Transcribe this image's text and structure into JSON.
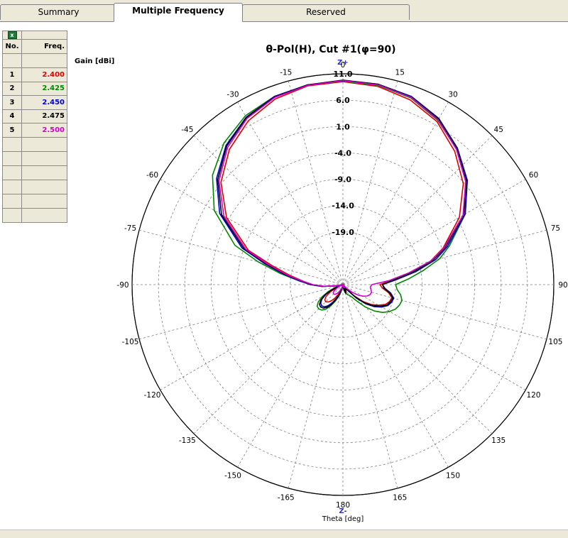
{
  "tabs": [
    {
      "label": "Summary",
      "active": false
    },
    {
      "label": "Multiple Frequency",
      "active": true
    },
    {
      "label": "Reserved",
      "active": false
    }
  ],
  "table": {
    "headers": [
      "No.",
      "Freq."
    ],
    "rows": [
      {
        "no": "1",
        "freq": "2.400",
        "color": "#e00000"
      },
      {
        "no": "2",
        "freq": "2.425",
        "color": "#008800"
      },
      {
        "no": "3",
        "freq": "2.450",
        "color": "#0000cc"
      },
      {
        "no": "4",
        "freq": "2.475",
        "color": "#000000"
      },
      {
        "no": "5",
        "freq": "2.500",
        "color": "#d000d0"
      }
    ],
    "blank_rows": 6
  },
  "chart_data": {
    "type": "polar",
    "title": "θ-Pol(H), Cut #1(φ=90)",
    "radial_label": "Gain [dBi]",
    "axis_label": "Theta [deg]",
    "top_marker": "Z+",
    "bottom_marker": "Z-",
    "radial_ticks": [
      "11.0",
      "6.0",
      "1.0",
      "-4.0",
      "-9.0",
      "-14.0",
      "-19.0"
    ],
    "radial_range": [
      -29,
      11
    ],
    "angle_step_deg": 15,
    "angle_tick_labels": [
      "0",
      "15",
      "30",
      "45",
      "60",
      "75",
      "90",
      "105",
      "120",
      "135",
      "150",
      "165",
      "180",
      "-165",
      "-150",
      "-135",
      "-120",
      "-105",
      "-90",
      "-75",
      "-60",
      "-45",
      "-30",
      "-15"
    ],
    "grid": true,
    "theta_deg": [
      0,
      10,
      20,
      30,
      40,
      50,
      60,
      70,
      75,
      80,
      85,
      90,
      95,
      100,
      105,
      110,
      115,
      120,
      125,
      130,
      135,
      140,
      145,
      150,
      155,
      160,
      165,
      170,
      175,
      180,
      -175,
      -170,
      -165,
      -160,
      -155,
      -150,
      -145,
      -140,
      -135,
      -130,
      -125,
      -120,
      -115,
      -110,
      -105,
      -100,
      -95,
      -90,
      -85,
      -80,
      -75,
      -70,
      -60,
      -50,
      -40,
      -30,
      -20,
      -10
    ],
    "series": [
      {
        "name": "2.400",
        "color": "#e00000",
        "values": [
          9.5,
          9.2,
          8.3,
          6.7,
          4.0,
          0.8,
          -3.5,
          -8.8,
          -11.8,
          -16.2,
          -19.8,
          -22.0,
          -21.5,
          -20.2,
          -19.4,
          -19.6,
          -20.1,
          -21.2,
          -22.4,
          -24.0,
          -26.0,
          -28.0,
          -28.6,
          -28.5,
          -28.0,
          -27.6,
          -27.8,
          -28.7,
          -29,
          -29,
          -29,
          -28.9,
          -28.4,
          -27.7,
          -27.0,
          -26.1,
          -25.3,
          -24.7,
          -24.4,
          -24.5,
          -25.1,
          -26.3,
          -28.0,
          -29,
          -29,
          -27.8,
          -25.3,
          -23.2,
          -21.4,
          -18.7,
          -15.1,
          -9.9,
          -3.5,
          1.2,
          4.5,
          6.9,
          8.5,
          9.3
        ]
      },
      {
        "name": "2.425",
        "color": "#008800",
        "values": [
          9.6,
          9.4,
          8.7,
          7.0,
          4.6,
          1.8,
          -2.2,
          -7.5,
          -10.0,
          -13.5,
          -16.5,
          -19.0,
          -18.7,
          -17.9,
          -17.4,
          -17.6,
          -18.0,
          -18.8,
          -19.8,
          -21.2,
          -23.0,
          -25.0,
          -26.2,
          -26.7,
          -26.9,
          -27.2,
          -27.6,
          -28.2,
          -28.8,
          -29,
          -28.9,
          -28.4,
          -27.6,
          -26.6,
          -25.5,
          -24.3,
          -23.3,
          -22.7,
          -22.5,
          -22.6,
          -23.3,
          -24.5,
          -26.0,
          -27.6,
          -28.6,
          -27.5,
          -25.0,
          -22.9,
          -20.6,
          -17.0,
          -12.4,
          -7.2,
          -0.8,
          3.3,
          6.1,
          8.0,
          9.0,
          9.5
        ]
      },
      {
        "name": "2.450",
        "color": "#0000cc",
        "values": [
          9.7,
          9.6,
          9.0,
          7.4,
          4.8,
          1.8,
          -2.2,
          -7.9,
          -10.8,
          -15.0,
          -19.0,
          -21.5,
          -21.0,
          -19.8,
          -19.0,
          -19.2,
          -19.6,
          -20.5,
          -21.7,
          -23.3,
          -25.4,
          -27.5,
          -28.2,
          -28.1,
          -27.9,
          -27.8,
          -28.0,
          -28.6,
          -29,
          -29,
          -29,
          -28.8,
          -28.1,
          -27.2,
          -26.2,
          -25.1,
          -24.1,
          -23.5,
          -23.3,
          -23.5,
          -24.1,
          -25.2,
          -26.7,
          -28.4,
          -29,
          -27.7,
          -25.0,
          -22.8,
          -20.7,
          -17.6,
          -13.6,
          -8.6,
          -2.0,
          2.3,
          5.5,
          7.7,
          9.0,
          9.5
        ]
      },
      {
        "name": "2.475",
        "color": "#000000",
        "values": [
          9.8,
          9.6,
          8.9,
          7.3,
          4.7,
          1.6,
          -2.5,
          -8.3,
          -11.3,
          -15.6,
          -19.5,
          -21.5,
          -21.2,
          -20.0,
          -19.2,
          -19.4,
          -19.8,
          -20.8,
          -22.0,
          -23.6,
          -25.7,
          -27.6,
          -28.2,
          -28.0,
          -27.6,
          -27.3,
          -27.5,
          -28.3,
          -29,
          -29,
          -29,
          -28.6,
          -27.9,
          -26.8,
          -25.8,
          -24.7,
          -23.7,
          -23.2,
          -23.0,
          -23.2,
          -23.9,
          -25.0,
          -26.6,
          -28.3,
          -29,
          -27.8,
          -25.2,
          -23.0,
          -21.0,
          -17.9,
          -14.0,
          -9.0,
          -2.4,
          2.0,
          5.3,
          7.6,
          8.9,
          9.5
        ]
      },
      {
        "name": "2.500",
        "color": "#d000d0",
        "values": [
          9.7,
          9.5,
          8.8,
          7.1,
          4.5,
          1.4,
          -2.7,
          -8.6,
          -11.8,
          -16.4,
          -20.2,
          -23.5,
          -23.8,
          -23.6,
          -23.4,
          -23.5,
          -23.9,
          -24.6,
          -25.6,
          -26.8,
          -28.0,
          -28.8,
          -29,
          -29,
          -28.8,
          -28.5,
          -28.4,
          -28.6,
          -28.9,
          -29,
          -29,
          -28.9,
          -28.6,
          -28.2,
          -27.8,
          -27.3,
          -26.9,
          -26.6,
          -26.5,
          -26.6,
          -27.0,
          -27.7,
          -28.5,
          -29,
          -29,
          -27.9,
          -25.4,
          -23.3,
          -21.2,
          -18.2,
          -14.4,
          -9.4,
          -2.9,
          1.7,
          5.0,
          7.4,
          8.8,
          9.4
        ]
      }
    ]
  }
}
